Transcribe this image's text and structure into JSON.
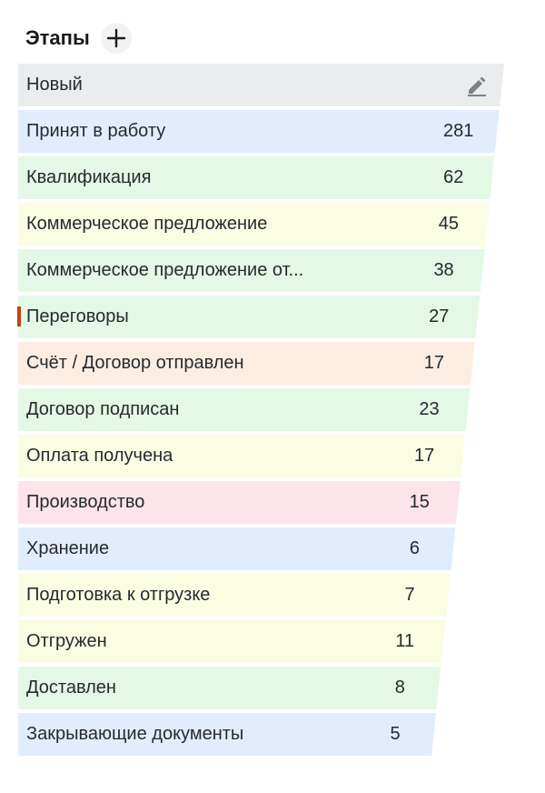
{
  "header": {
    "title": "Этапы",
    "add_icon": "plus-icon"
  },
  "stages": [
    {
      "label": "Новый",
      "count": "",
      "color": "#ebecee",
      "has_edit": true
    },
    {
      "label": "Принят в работу",
      "count": "281",
      "color": "#e1edfd"
    },
    {
      "label": "Квалификация",
      "count": "62",
      "color": "#e4f8e6"
    },
    {
      "label": "Коммерческое предложение",
      "count": "45",
      "color": "#fbfde3"
    },
    {
      "label": "Коммерческое предложение от...",
      "count": "38",
      "color": "#e4f8e6"
    },
    {
      "label": "Переговоры",
      "count": "27",
      "color": "#e4f8e6",
      "marker_color": "#c0441b"
    },
    {
      "label": "Счёт / Договор отправлен",
      "count": "17",
      "color": "#fdede1"
    },
    {
      "label": "Договор подписан",
      "count": "23",
      "color": "#e4f8e6"
    },
    {
      "label": "Оплата получена",
      "count": "17",
      "color": "#fbfde3"
    },
    {
      "label": "Производство",
      "count": "15",
      "color": "#fde3ea"
    },
    {
      "label": "Хранение",
      "count": "6",
      "color": "#e1edfd"
    },
    {
      "label": "Подготовка к отгрузке",
      "count": "7",
      "color": "#fbfde3"
    },
    {
      "label": "Отгружен",
      "count": "11",
      "color": "#fbfde3"
    },
    {
      "label": "Доставлен",
      "count": "8",
      "color": "#e4f8e6"
    },
    {
      "label": "Закрывающие документы",
      "count": "5",
      "color": "#e1edfd"
    }
  ]
}
